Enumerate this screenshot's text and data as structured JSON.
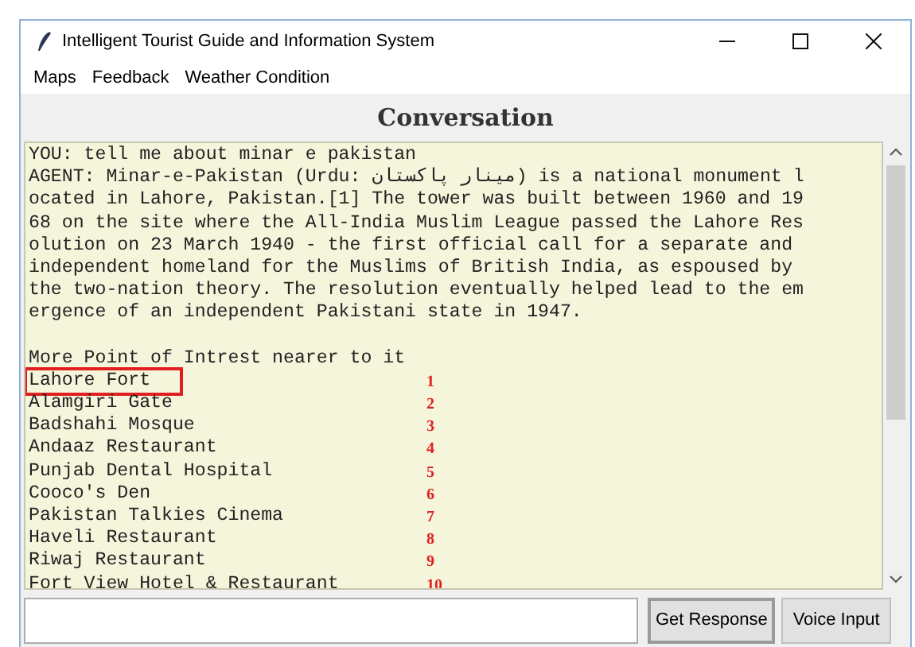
{
  "window": {
    "title": "Intelligent Tourist Guide and Information System"
  },
  "menu": [
    "Maps",
    "Feedback",
    "Weather Condition"
  ],
  "heading": "Conversation",
  "transcript": [
    "YOU: tell me about minar e pakistan",
    "AGENT: Minar-e-Pakistan (Urdu: مینار پاکستان) is a national monument l",
    "ocated in Lahore, Pakistan.[1] The tower was built between 1960 and 19",
    "68 on the site where the All-India Muslim League passed the Lahore Res",
    "olution on 23 March 1940 - the first official call for a separate and",
    "independent homeland for the Muslims of British India, as espoused by",
    "the two-nation theory. The resolution eventually helped lead to the em",
    "ergence of an independent Pakistani state in 1947."
  ],
  "poi_heading": "More Point of Intrest nearer to it",
  "places": [
    {
      "name": "Lahore Fort",
      "marker": "1",
      "highlighted": true
    },
    {
      "name": "Alamgiri Gate",
      "marker": "2",
      "highlighted": false
    },
    {
      "name": "Badshahi Mosque",
      "marker": "3",
      "highlighted": false
    },
    {
      "name": "Andaaz Restaurant",
      "marker": "4",
      "highlighted": false
    },
    {
      "name": "Punjab Dental Hospital",
      "marker": "5",
      "highlighted": false
    },
    {
      "name": "Cooco's Den",
      "marker": "6",
      "highlighted": false
    },
    {
      "name": "Pakistan Talkies Cinema",
      "marker": "7",
      "highlighted": false
    },
    {
      "name": "Haveli Restaurant",
      "marker": "8",
      "highlighted": false
    },
    {
      "name": "Riwaj Restaurant",
      "marker": "9",
      "highlighted": false
    },
    {
      "name": "Fort View Hotel & Restaurant",
      "marker": "10",
      "highlighted": false
    }
  ],
  "buttons": [
    "Get Response",
    "Voice Input"
  ]
}
